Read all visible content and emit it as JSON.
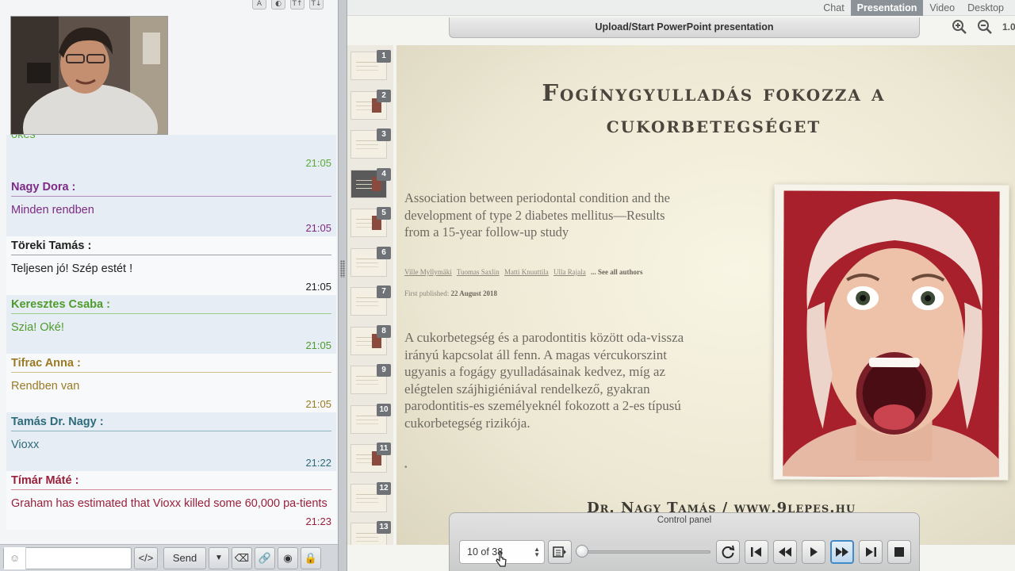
{
  "chat": {
    "partial_message": {
      "text": "okés",
      "time": "21:05",
      "color": "#5aaa3a"
    },
    "messages": [
      {
        "name": "Nagy Dora :",
        "text": "Minden rendben",
        "time": "21:05",
        "color": "#7c2a86",
        "line": "#b68bbd",
        "shaded": true
      },
      {
        "name": "Töreki Tamás :",
        "text": "Teljesen jó! Szép estét !",
        "time": "21:05",
        "color": "#222222",
        "line": "#9aa0a6",
        "shaded": false
      },
      {
        "name": "Keresztes Csaba :",
        "text": "Szia! Oké!",
        "time": "21:05",
        "color": "#4e9c2c",
        "line": "#9ccc86",
        "shaded": true
      },
      {
        "name": "Tifrac Anna :",
        "text": "Rendben van",
        "time": "21:05",
        "color": "#9a7a22",
        "line": "#cfbf8a",
        "shaded": false
      },
      {
        "name": "Tamás Dr. Nagy :",
        "text": "Vioxx",
        "time": "21:22",
        "color": "#2d6a7a",
        "line": "#8fb6c0",
        "shaded": true
      },
      {
        "name": "Tímár Máté :",
        "text": "Graham has estimated that Vioxx killed some 60,000 pa-tients",
        "time": "21:23",
        "color": "#9a1f3a",
        "line": "#d08a9a",
        "shaded": false
      }
    ],
    "input_placeholder": "",
    "send_label": "Send"
  },
  "tabs": [
    {
      "label": "Chat",
      "active": false
    },
    {
      "label": "Presentation",
      "active": true
    },
    {
      "label": "Video",
      "active": false
    },
    {
      "label": "Desktop",
      "active": false
    }
  ],
  "upload_label": "Upload/Start PowerPoint presentation",
  "zoom_level": "1.0",
  "thumbnails": [
    "1",
    "2",
    "3",
    "4",
    "5",
    "6",
    "7",
    "8",
    "9",
    "10",
    "11",
    "12",
    "13"
  ],
  "active_thumbnail": "4",
  "slide": {
    "title": "Fogínygyulladás fokozza a cukorbetegséget",
    "paper_title": "Association between periodontal condition and the development of type 2 diabetes mellitus—Results from a 15-year follow-up study",
    "authors": [
      "Ville Myllymäki",
      "Tuomas Saxlin",
      "Matti Knuuttila",
      "Ulla Rajala"
    ],
    "see_all": "... See all authors",
    "published_label": "First published:",
    "published_date": "22 August 2018",
    "body": "A cukorbetegség és a parodontitis között oda-vissza irányú kapcsolat áll fenn. A magas vércukorszint ugyanis a fogágy gyulladásainak kedvez, míg az elégtelen szájhigiéniával rendelkező, gyakran parodontitis-es személyeknél fokozott a 2-es típusú cukorbetegség rizikója.",
    "bullet": "•",
    "footer": "Dr. Nagy Tamás / www.9lepes.hu"
  },
  "control_panel": {
    "title": "Control panel",
    "page_indicator": "10 of 38",
    "slider_progress": 0.0
  }
}
